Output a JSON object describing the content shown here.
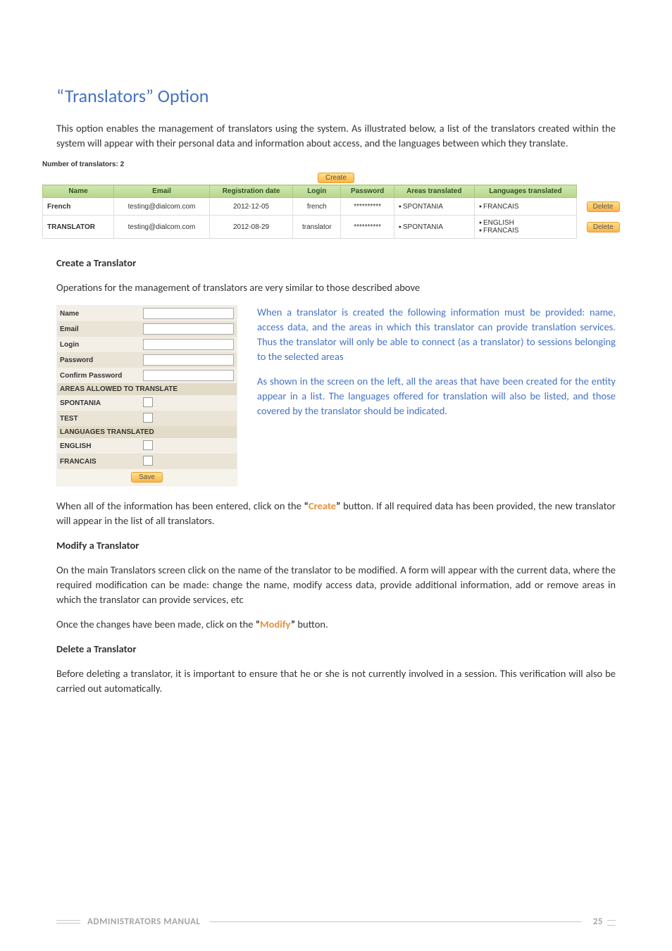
{
  "title": "“Translators” Option",
  "intro": "This option enables the management of translators using the system. As illustrated below, a list of the translators created within the system will appear with their personal data and information about access, and the languages between which they translate.",
  "shot1": {
    "numberLabel": "Number of translators: 2",
    "createBtn": "Create",
    "headers": [
      "Name",
      "Email",
      "Registration date",
      "Login",
      "Password",
      "Areas translated",
      "Languages translated"
    ],
    "rows": [
      {
        "name": "French",
        "email": "testing@dialcom.com",
        "date": "2012-12-05",
        "login": "french",
        "password": "**********",
        "areas": [
          "SPONTANIA"
        ],
        "langs": [
          "FRANCAIS"
        ]
      },
      {
        "name": "TRANSLATOR",
        "email": "testing@dialcom.com",
        "date": "2012-08-29",
        "login": "translator",
        "password": "**********",
        "areas": [
          "SPONTANIA"
        ],
        "langs": [
          "ENGLISH",
          "FRANCAIS"
        ]
      }
    ],
    "deleteBtn": "Delete"
  },
  "createHeading": "Create a Translator",
  "createIntro": "Operations for the management of translators are very similar to those described above",
  "shot2": {
    "fields": {
      "name": "Name",
      "email": "Email",
      "login": "Login",
      "password": "Password",
      "confirm": "Confirm Password"
    },
    "areasHdr": "AREAS ALLOWED TO TRANSLATE",
    "areas": [
      "SPONTANIA",
      "TEST"
    ],
    "langsHdr": "LANGUAGES TRANSLATED",
    "langs": [
      "ENGLISH",
      "FRANCAIS"
    ],
    "saveBtn": "Save"
  },
  "sideText1": "When a translator is created the following information must be provided: name, access data, and the areas in which this translator can provide translation services. Thus the translator will only be able to connect (as a translator) to sessions belonging to the selected areas",
  "sideText2": "As shown in the screen on the left, all the areas that have been created for the entity appear in a list. The languages offered for translation will also be listed, and those covered by the translator should be indicated.",
  "afterForm_pre": "When all of the information has been entered, click on the ",
  "afterForm_quote_open": "“",
  "afterForm_word": "Create",
  "afterForm_quote_close": "”",
  "afterForm_post": " button. If all required data has been provided, the new translator will appear in the list of all translators.",
  "modifyHeading": "Modify a Translator",
  "modifyBody": "On the main Translators screen click on the name of the translator to be modified. A form will appear with the current data, where the required modification can be made: change the name, modify access data, provide additional information, add or remove areas in which the translator can provide services, etc",
  "modifyClick_pre": "Once the changes have been made, click on the ",
  "modifyClick_word": "Modify",
  "modifyClick_post": " button.",
  "deleteHeading": "Delete a Translator",
  "deleteBody": "Before deleting a translator, it is important to ensure that he or she is not currently involved in a session. This verification will also be carried out automatically.",
  "footer": {
    "label": "ADMINISTRATORS MANUAL",
    "page": "25"
  }
}
